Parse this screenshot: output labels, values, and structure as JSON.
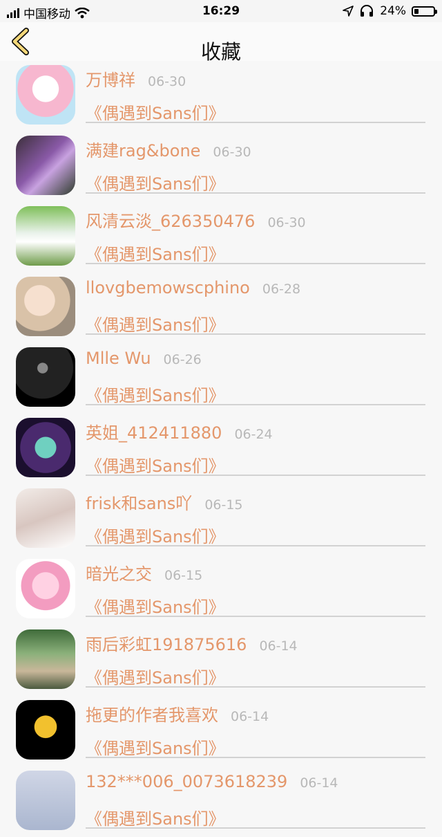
{
  "status_bar": {
    "carrier": "中国移动",
    "time": "16:29",
    "battery_percent": "24%",
    "battery_level": 0.24
  },
  "nav": {
    "title": "收藏",
    "back_icon": "chevron-left-icon",
    "accent": "#e4976b"
  },
  "items": [
    {
      "name": "万博祥",
      "date": "06-30",
      "title": "《偶遇到Sans们》"
    },
    {
      "name": "满建rag&bone",
      "date": "06-30",
      "title": "《偶遇到Sans们》"
    },
    {
      "name": "风清云淡_626350476",
      "date": "06-30",
      "title": "《偶遇到Sans们》"
    },
    {
      "name": "llovgbemowscphino",
      "date": "06-28",
      "title": "《偶遇到Sans们》"
    },
    {
      "name": "Mlle Wu",
      "date": "06-26",
      "title": "《偶遇到Sans们》"
    },
    {
      "name": "英姐_412411880",
      "date": "06-24",
      "title": "《偶遇到Sans们》"
    },
    {
      "name": "frisk和sans吖",
      "date": "06-15",
      "title": "《偶遇到Sans们》"
    },
    {
      "name": "暗光之交",
      "date": "06-15",
      "title": "《偶遇到Sans们》"
    },
    {
      "name": "雨后彩虹191875616",
      "date": "06-14",
      "title": "《偶遇到Sans们》"
    },
    {
      "name": "拖更的作者我喜欢",
      "date": "06-14",
      "title": "《偶遇到Sans们》"
    },
    {
      "name": "132***006_0073618239",
      "date": "06-14",
      "title": "《偶遇到Sans们》"
    }
  ]
}
